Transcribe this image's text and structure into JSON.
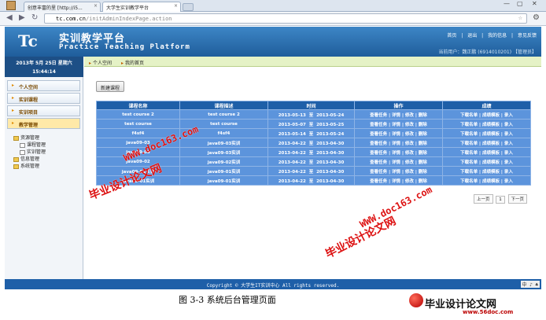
{
  "browser": {
    "tabs": [
      {
        "label": "创意丰富的里 [http://i5..."
      },
      {
        "label": "大学生实训教学平台"
      }
    ],
    "url_host": "tc.com.cn",
    "url_path": "/initAdminIndexPage.action"
  },
  "header": {
    "logo": "Tc",
    "title": "实训教学平台",
    "subtitle": "Practice Teaching Platform",
    "links": [
      "首页",
      "|",
      "退出",
      "|",
      "我的信息",
      "|",
      "意见反馈"
    ],
    "user": "当前用户：魏正鹏 (6914010201) 【管理员】"
  },
  "datebar": {
    "date": "2013年 5月 25日 星期六",
    "time": "15:44:14"
  },
  "breadcrumb": [
    "个人空间",
    "我的首页"
  ],
  "sidebar": {
    "menus": [
      "个人空间",
      "实训课程",
      "实训项目",
      "教学管理"
    ],
    "tree": [
      "资源管理",
      "课程管理",
      "实训管理",
      "信息管理",
      "系统管理"
    ]
  },
  "main": {
    "new_button": "新建课程",
    "columns": [
      "课程名称",
      "课程描述",
      "时间",
      "操作",
      "成绩"
    ],
    "time_sep": "至",
    "actions": [
      "查看任务",
      "|",
      "详情",
      "|",
      "修改",
      "|",
      "删除"
    ],
    "grade_actions": [
      "下载名单",
      "|",
      "成绩模板",
      "|",
      "录入"
    ],
    "rows": [
      {
        "name": "test course 2",
        "desc": "test course 2",
        "start": "2013-05-13",
        "end": "2013-05-24"
      },
      {
        "name": "test course",
        "desc": "test course",
        "start": "2013-05-07",
        "end": "2013-05-25"
      },
      {
        "name": "f4sf4",
        "desc": "f4sf4",
        "start": "2013-05-14",
        "end": "2013-05-24"
      },
      {
        "name": "java09-03",
        "desc": "java09-03实训",
        "start": "2013-04-22",
        "end": "2013-04-30"
      },
      {
        "name": "java09-03",
        "desc": "java09-03实训",
        "start": "2013-04-22",
        "end": "2013-04-30"
      },
      {
        "name": "java09-02",
        "desc": "java09-02实训",
        "start": "2013-04-22",
        "end": "2013-04-30"
      },
      {
        "name": "java09-01实训",
        "desc": "java09-01实训",
        "start": "2013-04-22",
        "end": "2013-04-30"
      },
      {
        "name": "java09-01实训",
        "desc": "java09-01实训",
        "start": "2013-04-22",
        "end": "2013-04-30"
      }
    ],
    "pager": [
      "上一页",
      "1",
      "下一页"
    ]
  },
  "footer": {
    "copyright": "Copyright © 大学生IT实训中心 All rights reserved.",
    "ime": "中 ♪ ♣"
  },
  "caption": "图 3-3 系统后台管理页面",
  "watermarks": {
    "url": "WWW.doc163.com",
    "cn": "毕业设计论文网",
    "site": "毕业设计论文网",
    "site_url": "www.56doc.com"
  }
}
